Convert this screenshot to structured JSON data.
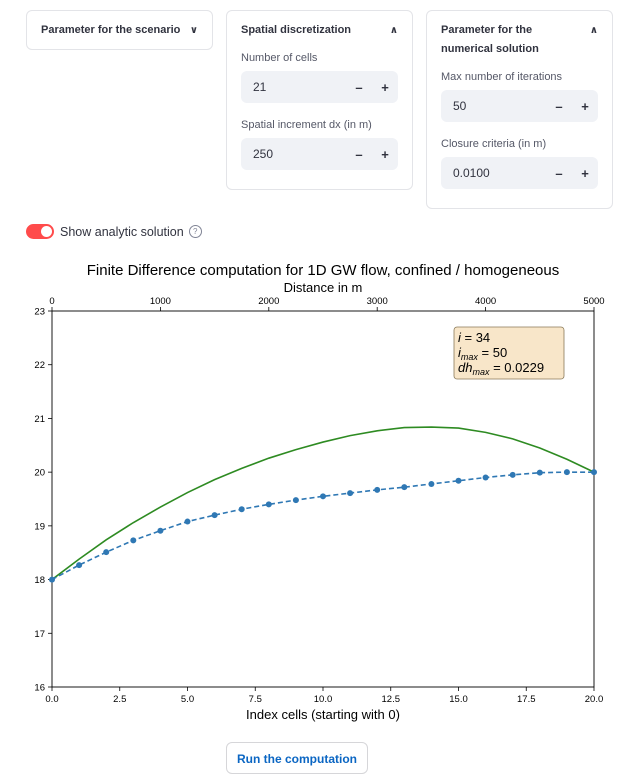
{
  "panels": {
    "scenario": {
      "title": "Parameter for the scenario",
      "chevron": "chevron-down-icon"
    },
    "spatial": {
      "title": "Spatial discretization",
      "chevron": "chevron-up-icon",
      "cells_label": "Number of cells",
      "cells_value": "21",
      "dx_label": "Spatial increment dx (in m)",
      "dx_value": "250"
    },
    "numerical": {
      "title": "Parameter for the numerical solution",
      "chevron": "chevron-up-icon",
      "iter_label": "Max number of iterations",
      "iter_value": "50",
      "closure_label": "Closure criteria (in m)",
      "closure_value": "0.0100"
    }
  },
  "stepper": {
    "minus": "–",
    "plus": "+"
  },
  "toggle": {
    "label": "Show analytic solution",
    "checked": true,
    "help": "?"
  },
  "run_button": "Run the computation",
  "colors": {
    "accent": "#ff4b4b",
    "analytic": "#2e8b22",
    "numeric": "#2f78b4",
    "link": "#0b66c3"
  },
  "chart_data": {
    "type": "line",
    "title": "Finite Difference computation for 1D GW flow, confined / homogeneous",
    "xlabel": "Index cells (starting with 0)",
    "x2label": "Distance in m",
    "ylabel": "",
    "xlim": [
      0,
      20
    ],
    "x2lim": [
      0,
      5000
    ],
    "ylim": [
      16,
      23
    ],
    "xticks": [
      "0.0",
      "2.5",
      "5.0",
      "7.5",
      "10.0",
      "12.5",
      "15.0",
      "17.5",
      "20.0"
    ],
    "x2ticks": [
      "0",
      "1000",
      "2000",
      "3000",
      "4000",
      "5000"
    ],
    "yticks": [
      "16",
      "17",
      "18",
      "19",
      "20",
      "21",
      "22",
      "23"
    ],
    "grid": false,
    "annotation": {
      "i": "34",
      "imax": "50",
      "dhmax": "0.0229",
      "placement": "top-right"
    },
    "series": [
      {
        "style": "solid",
        "color": "#2e8b22",
        "x": [
          0,
          1,
          2,
          3,
          4,
          5,
          6,
          7,
          8,
          9,
          10,
          11,
          12,
          13,
          14,
          15,
          16,
          17,
          18,
          19,
          20
        ],
        "y": [
          18.0,
          18.38,
          18.74,
          19.06,
          19.35,
          19.62,
          19.86,
          20.07,
          20.26,
          20.42,
          20.56,
          20.68,
          20.77,
          20.83,
          20.84,
          20.82,
          20.74,
          20.62,
          20.45,
          20.24,
          20.0
        ]
      },
      {
        "style": "dashed",
        "color": "#2f78b4",
        "marker": "circle",
        "x": [
          0,
          1,
          2,
          3,
          4,
          5,
          6,
          7,
          8,
          9,
          10,
          11,
          12,
          13,
          14,
          15,
          16,
          17,
          18,
          19,
          20
        ],
        "y": [
          18.0,
          18.27,
          18.51,
          18.73,
          18.91,
          19.08,
          19.2,
          19.31,
          19.4,
          19.48,
          19.55,
          19.61,
          19.67,
          19.72,
          19.78,
          19.84,
          19.9,
          19.95,
          19.99,
          20.0,
          20.0
        ]
      }
    ]
  }
}
